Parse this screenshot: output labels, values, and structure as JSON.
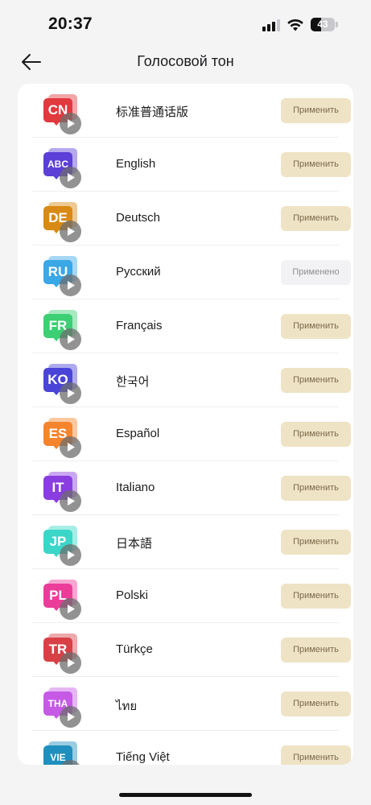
{
  "status": {
    "time": "20:37",
    "battery": "43"
  },
  "header": {
    "title": "Голосовой тон"
  },
  "languages": [
    {
      "code": "CN",
      "name": "标准普通话版",
      "button": "Применить",
      "applied": false,
      "color": "#e0393e"
    },
    {
      "code": "ABC",
      "name": "English",
      "button": "Применить",
      "applied": false,
      "color": "#5b3fd6"
    },
    {
      "code": "DE",
      "name": "Deutsch",
      "button": "Применить",
      "applied": false,
      "color": "#d88a14"
    },
    {
      "code": "RU",
      "name": "Русский",
      "button": "Применено",
      "applied": true,
      "color": "#3aa7e6"
    },
    {
      "code": "FR",
      "name": "Français",
      "button": "Применить",
      "applied": false,
      "color": "#3ccf74"
    },
    {
      "code": "KO",
      "name": "한국어",
      "button": "Применить",
      "applied": false,
      "color": "#4a45d8"
    },
    {
      "code": "ES",
      "name": "Español",
      "button": "Применить",
      "applied": false,
      "color": "#f5842c"
    },
    {
      "code": "IT",
      "name": "Italiano",
      "button": "Применить",
      "applied": false,
      "color": "#8a3de0"
    },
    {
      "code": "JP",
      "name": "日本語",
      "button": "Применить",
      "applied": false,
      "color": "#3ad6c8"
    },
    {
      "code": "PL",
      "name": "Polski",
      "button": "Применить",
      "applied": false,
      "color": "#ec3c9a"
    },
    {
      "code": "TR",
      "name": "Türkçe",
      "button": "Применить",
      "applied": false,
      "color": "#d84046"
    },
    {
      "code": "THA",
      "name": "ไทย",
      "button": "Применить",
      "applied": false,
      "color": "#c65ae6"
    },
    {
      "code": "VIE",
      "name": "Tiếng Việt",
      "button": "Применить",
      "applied": false,
      "color": "#1f8fbf"
    }
  ]
}
